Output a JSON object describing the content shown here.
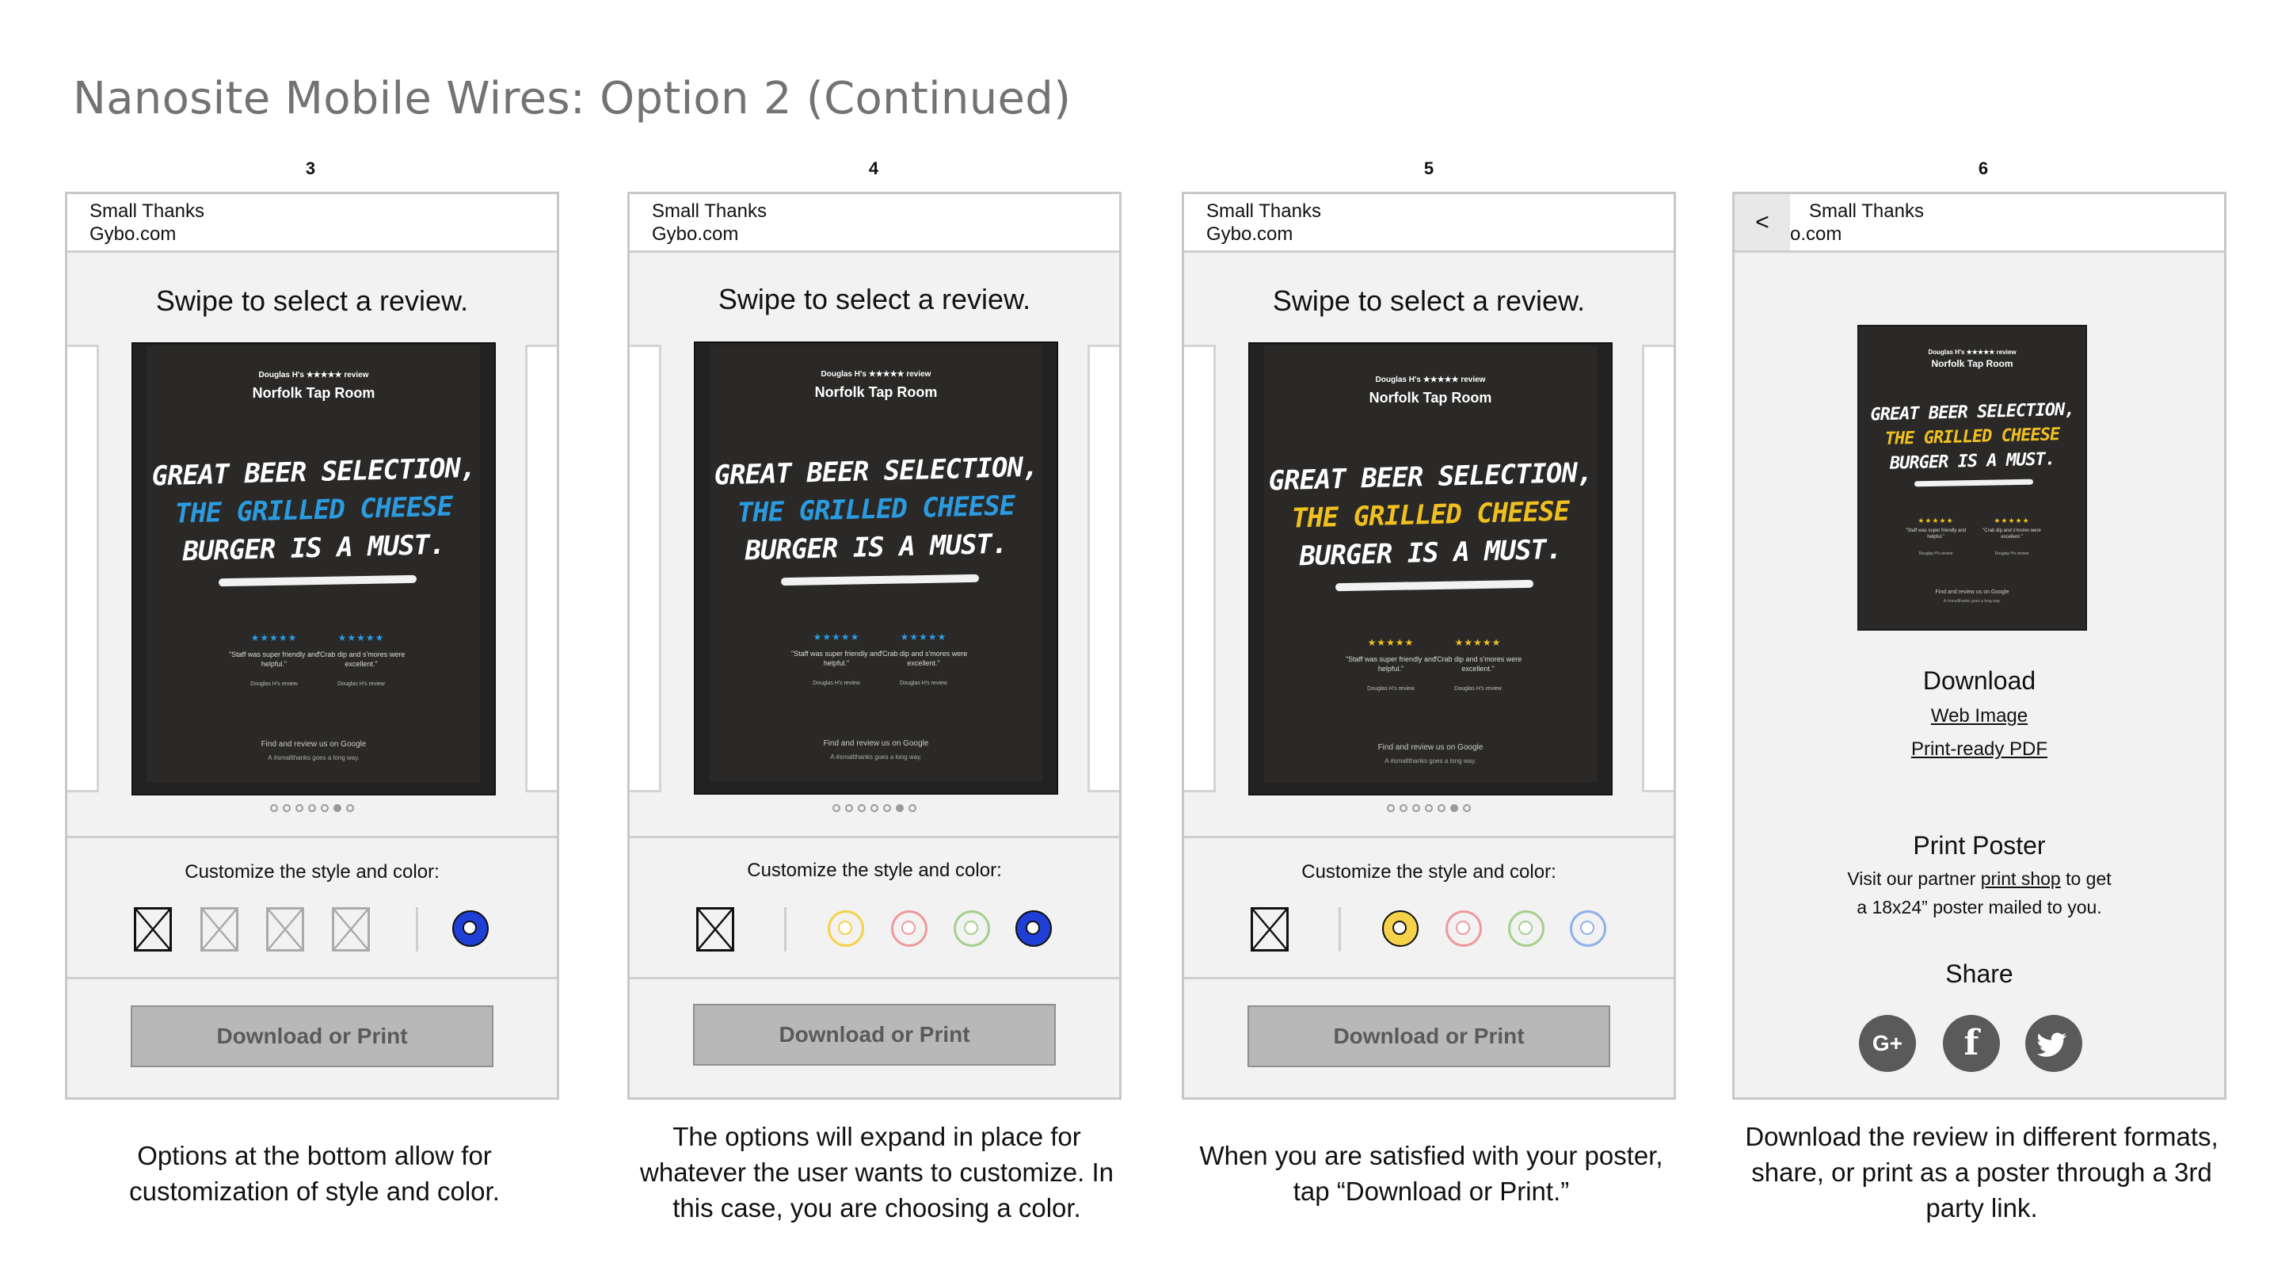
{
  "page": {
    "title": "Nanosite Mobile Wires: Option 2 (Continued)"
  },
  "header": {
    "app_name": "Small Thanks",
    "domain": "Gybo.com",
    "domain_truncated": "o.com",
    "back_label": "<"
  },
  "poster": {
    "byline": "Douglas H's ★★★★★ review",
    "venue": "Norfolk Tap Room",
    "headline_1": "GREAT BEER SELECTION,",
    "headline_2": "THE GRILLED CHEESE",
    "headline_3": "BURGER IS A MUST.",
    "stars": "★★★★★",
    "quote_1": "\"Staff was super friendly and helpful.\"",
    "quote_2": "\"Crab dip and s'mores were excellent.\"",
    "reviewer": "Douglas H's review",
    "find": "Find and review us on Google",
    "tagline": "A #smallthanks goes a long way."
  },
  "common": {
    "swipe_title": "Swipe to select a review.",
    "customize_label": "Customize the style and color:",
    "download_button": "Download or Print"
  },
  "screens": [
    {
      "number": "3",
      "accent": "#2b9be0",
      "active_dot": 5,
      "caption": "Options at the bottom allow for customization of style and color."
    },
    {
      "number": "4",
      "accent": "#2b9be0",
      "active_dot": 6,
      "caption": "The options will expand in place for whatever the user wants to customize. In this case, you are choosing a color."
    },
    {
      "number": "5",
      "accent": "#f0c020",
      "active_dot": 6,
      "caption": "When you are satisfied with your poster, tap “Download or Print.”"
    },
    {
      "number": "6",
      "accent": "#f0c020",
      "caption": "Download the review in different formats, share, or print as a poster through a 3rd party link."
    }
  ],
  "swatch_colors": {
    "yellow": "#f5d24a",
    "pink": "#ee9a9a",
    "green": "#a6cf8e",
    "blue": "#1f3fd6",
    "lightblue": "#8fb0ec"
  },
  "download_panel": {
    "heading": "Download",
    "web_image": "Web Image",
    "print_pdf": "Print-ready PDF",
    "print_heading": "Print Poster",
    "print_text_pre": "Visit our partner",
    "print_link": "print shop",
    "print_text_post": "to get",
    "print_text_line2": "a 18x24” poster mailed to you.",
    "share_heading": "Share",
    "google_label": "G+",
    "facebook_label": "f",
    "twitter_label": "t"
  }
}
